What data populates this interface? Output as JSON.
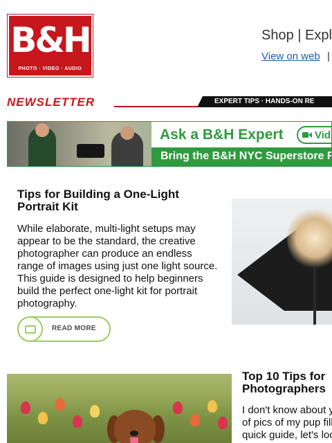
{
  "logo": {
    "mark": "B&H",
    "tagline": "PHOTO · VIDEO · AUDIO"
  },
  "header": {
    "links_text": "Shop | Expl",
    "view_on_web": "View on web",
    "separator": "|"
  },
  "newsletter": {
    "label": "NEWSLETTER",
    "strip_text": "EXPERT TIPS · HANDS-ON RE"
  },
  "banner": {
    "title": "Ask a B&H Expert",
    "video_button": "Video",
    "subtitle": "Bring the B&H NYC Superstore Ri"
  },
  "article1": {
    "title": "Tips for Building a One-Light Portrait Kit",
    "body": "While elaborate, multi-light setups may appear to be the standard, the creative photographer can produce an endless range of images using just one light source. This guide is designed to help beginners build the perfect one-light kit for portrait photography.",
    "cta_label": "READ MORE"
  },
  "article2": {
    "title_line1": "Top 10 Tips for",
    "title_line2": "Photographers",
    "body_line1": "I don't know about y",
    "body_line2": "of pics of my pup fill",
    "body_line3": "quick guide, let's loo"
  },
  "colors": {
    "brand_red": "#c8161d",
    "expert_green": "#2e9b3f",
    "cta_green": "#9ccc65",
    "link_blue": "#1a5fa8"
  },
  "icons": [
    "newsletter-icon",
    "video-icon"
  ]
}
